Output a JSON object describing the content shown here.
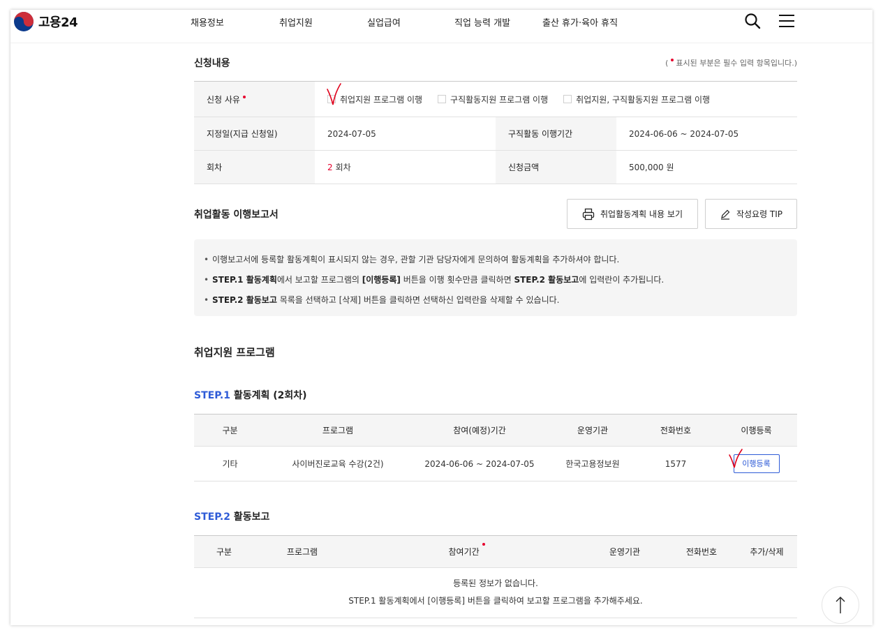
{
  "header": {
    "logo_text": "고용24",
    "menu": [
      "채용정보",
      "취업지원",
      "실업급여",
      "직업 능력 개발",
      "출산 휴가·육아 휴직"
    ]
  },
  "application": {
    "title": "신청내용",
    "required_note": "표시된 부분은 필수 입력 항목입니다.",
    "reason_label": "신청 사유",
    "reason_options": [
      "취업지원 프로그램 이행",
      "구직활동지원 프로그램 이행",
      "취업지원, 구직활동지원 프로그램 이행"
    ],
    "designated_label": "지정일(지급 신청일)",
    "designated_value": "2024-07-05",
    "period_label": "구직활동 이행기간",
    "period_value": "2024-06-06 ~ 2024-07-05",
    "round_label": "회차",
    "round_number": "2",
    "round_suffix": "회차",
    "amount_label": "신청금액",
    "amount_value": "500,000 원"
  },
  "report": {
    "title": "취업활동 이행보고서",
    "view_plan_button": "취업활동계획 내용 보기",
    "tip_button": "작성요령 TIP",
    "notices": {
      "n1": "이행보고서에 등록할 활동계획이 표시되지 않는 경우, 관할 기관 담당자에게 문의하여 활동계획을 추가하셔야 합니다.",
      "n2_b1": "STEP.1 활동계획",
      "n2_t1": "에서 보고할 프로그램의 ",
      "n2_b2": "[이행등록]",
      "n2_t2": " 버튼을 이행 횟수만큼 클릭하면 ",
      "n2_b3": "STEP.2 활동보고",
      "n2_t3": "에 입력란이 추가됩니다.",
      "n3_b1": "STEP.2 활동보고",
      "n3_t1": " 목록을 선택하고 [삭제] 버튼을 클릭하면 선택하신 입력란을 삭제할 수 있습니다."
    }
  },
  "program": {
    "title": "취업지원 프로그램",
    "step1": {
      "step_label": "STEP.1",
      "title": " 활동계획 (2회차)",
      "headers": [
        "구분",
        "프로그램",
        "참여(예정)기간",
        "운영기관",
        "전화번호",
        "이행등록"
      ],
      "row": {
        "category": "기타",
        "program": "사이버진로교육 수강(2건)",
        "period": "2024-06-06 ~ 2024-07-05",
        "agency": "한국고용정보원",
        "phone": "1577",
        "register_button": "이행등록"
      }
    },
    "step2": {
      "step_label": "STEP.2",
      "title": " 활동보고",
      "headers": [
        "구분",
        "프로그램",
        "참여기간",
        "운영기관",
        "전화번호",
        "추가/삭제"
      ],
      "empty_line1": "등록된 정보가 없습니다.",
      "empty_line2": "STEP.1 활동계획에서 [이행등록] 버튼을 클릭하여 보고할 프로그램을 추가해주세요."
    }
  },
  "colors": {
    "accent_blue": "#2e5bd7",
    "required_red": "#e6002d"
  }
}
